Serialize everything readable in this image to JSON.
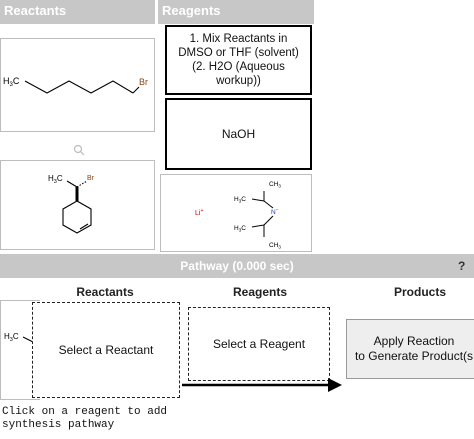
{
  "reactants_panel": {
    "title": "Reactants",
    "reactant1": {
      "label_h3c": "H",
      "label_sub": "3",
      "label_c": "C",
      "label_br": "Br"
    },
    "reactant2": {
      "label_h3c": "H",
      "label_sub": "3",
      "label_c": "C",
      "label_br": "Br"
    }
  },
  "reagents_panel": {
    "title": "Reagents",
    "reagent1_lines": [
      "1. Mix Reactants in",
      "DMSO or THF (solvent)",
      "(2. H2O (Aqueous",
      "workup))"
    ],
    "reagent2": "NaOH",
    "reagent3": {
      "li": "Li",
      "li_charge": "+",
      "n": "N",
      "n_charge": "−",
      "ch3": "CH",
      "h3c": "H",
      "sub3": "3",
      "c": "C"
    }
  },
  "pathway": {
    "title": "Pathway (0.000 sec)",
    "help": "?",
    "columns": {
      "reactants": "Reactants",
      "reagents": "Reagents",
      "products": "Products"
    },
    "select_reactant": "Select a Reactant",
    "select_reagent": "Select a Reagent",
    "apply_line1": "Apply Reaction",
    "apply_line2": "to Generate Product(s",
    "reactant_preview": {
      "h3c": "H",
      "sub3": "3",
      "c": "C"
    },
    "hint_line1": "Click on a reagent to add",
    "hint_line2": "synthesis pathway"
  },
  "colors": {
    "header_bg": "#c7c7c7",
    "accent_text": "#ffffff",
    "li_color": "#cc0000",
    "br_color": "#8b4513"
  }
}
